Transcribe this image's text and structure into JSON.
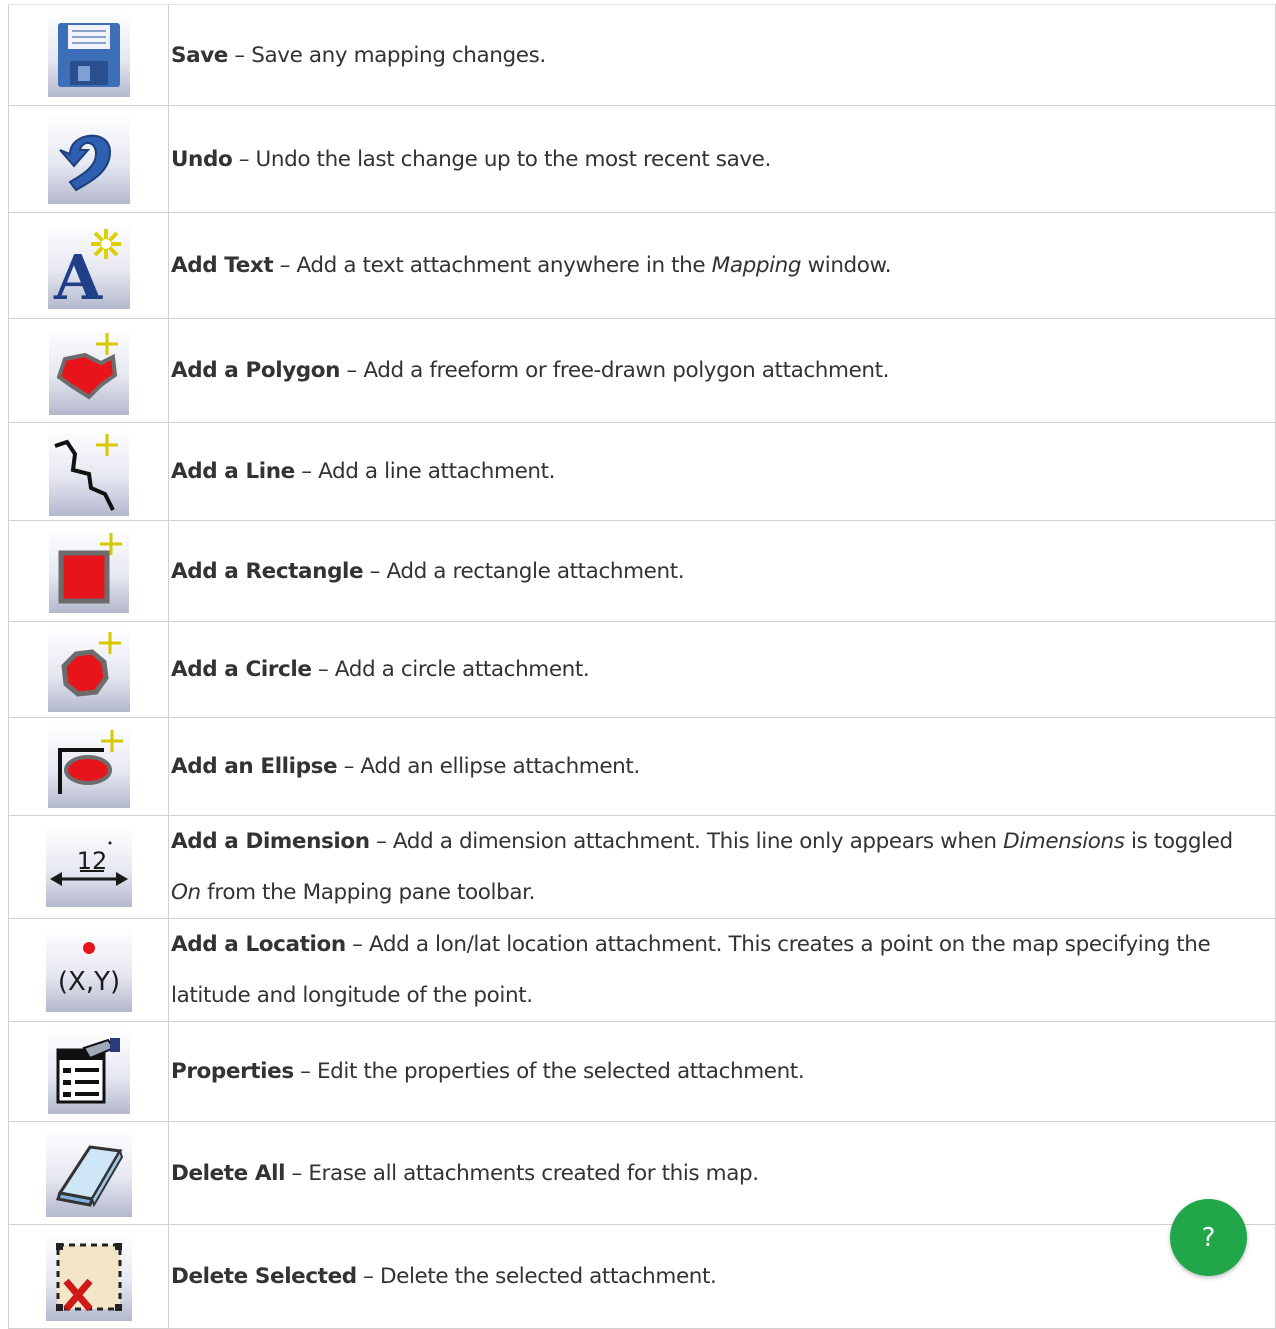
{
  "help_button": {
    "label": "?",
    "color": "#21a649"
  },
  "rows": [
    {
      "icon": "save-icon",
      "name": "Save",
      "desc": "Save any mapping changes."
    },
    {
      "icon": "undo-icon",
      "name": "Undo",
      "desc": "Undo the last change up to the most recent save."
    },
    {
      "icon": "add-text-icon",
      "name": "Add Text",
      "desc_a": "Add a text attachment anywhere in the ",
      "desc_em": "Mapping",
      "desc_b": " window."
    },
    {
      "icon": "add-polygon-icon",
      "name": "Add a Polygon",
      "desc": "Add a freeform or free-drawn polygon attachment."
    },
    {
      "icon": "add-line-icon",
      "name": "Add a Line",
      "desc": "Add a line attachment."
    },
    {
      "icon": "add-rectangle-icon",
      "name": "Add a Rectangle",
      "desc": "Add a rectangle attachment."
    },
    {
      "icon": "add-circle-icon",
      "name": "Add a Circle",
      "desc": "Add a circle attachment."
    },
    {
      "icon": "add-ellipse-icon",
      "name": "Add an Ellipse",
      "desc": "Add an ellipse attachment."
    },
    {
      "icon": "add-dimension-icon",
      "name": "Add a Dimension",
      "icon_label": "12",
      "desc_a": "Add a dimension attachment. This line only appears when ",
      "desc_em": "Dimensions",
      "desc_b": " is toggled ",
      "desc_em2": "On",
      "desc_c": " from the Mapping pane toolbar."
    },
    {
      "icon": "add-location-icon",
      "name": "Add a Location",
      "icon_label": "(X,Y)",
      "desc": "Add a lon/lat location attachment. This creates a point on the map specifying the latitude and longitude of the point."
    },
    {
      "icon": "properties-icon",
      "name": "Properties",
      "desc": "Edit the properties of the selected attachment."
    },
    {
      "icon": "delete-all-icon",
      "name": "Delete All",
      "desc": "Erase all attachments created for this map."
    },
    {
      "icon": "delete-selected-icon",
      "name": "Delete Selected",
      "desc": "Delete the selected attachment."
    }
  ],
  "sep": " – "
}
